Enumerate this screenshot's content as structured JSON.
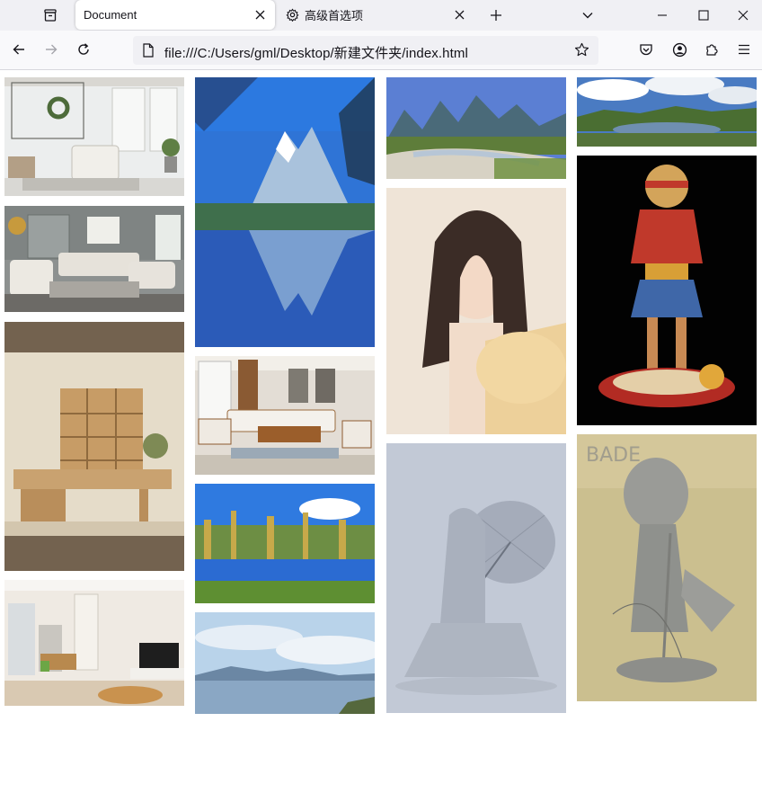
{
  "browser": {
    "tabs": [
      {
        "title": "Document",
        "active": true
      },
      {
        "title": "高级首选项",
        "active": false,
        "icon": "gear-icon"
      }
    ],
    "url": "file:///C:/Users/gml/Desktop/新建文件夹/index.html",
    "icons": {
      "tab_overview": "tab-overview-icon",
      "new_tab": "plus-icon",
      "list_tabs": "chevron-down-icon",
      "back": "arrow-left-icon",
      "forward": "arrow-right-icon",
      "reload": "reload-icon",
      "page": "page-icon",
      "bookmark": "star-icon",
      "pocket": "pocket-icon",
      "account": "account-icon",
      "extensions": "extensions-icon",
      "menu": "hamburger-menu-icon",
      "minimize": "minimize-icon",
      "maximize": "maximize-icon",
      "close": "close-icon"
    }
  },
  "gallery": {
    "columns": [
      [
        {
          "subject": "white living room with wreath"
        },
        {
          "subject": "grey living room with sofas"
        },
        {
          "subject": "wooden study furniture"
        },
        {
          "subject": "apartment interior with tv"
        }
      ],
      [
        {
          "subject": "snow mountain lake reflection"
        },
        {
          "subject": "wooden sofa living room"
        },
        {
          "subject": "autumn forest lake"
        },
        {
          "subject": "sky over lake"
        }
      ],
      [
        {
          "subject": "karst river landscape"
        },
        {
          "subject": "portrait of woman"
        },
        {
          "subject": "grey kneeling figure with umbrella"
        }
      ],
      [
        {
          "subject": "valley with cloudy sky"
        },
        {
          "subject": "one piece luffy figure"
        },
        {
          "subject": "grey anime figure on plinth"
        }
      ]
    ]
  },
  "colors": {
    "tabstrip": "#f0f0f4",
    "navbar": "#f9f9fb",
    "urlbar": "#f0f0f4"
  }
}
